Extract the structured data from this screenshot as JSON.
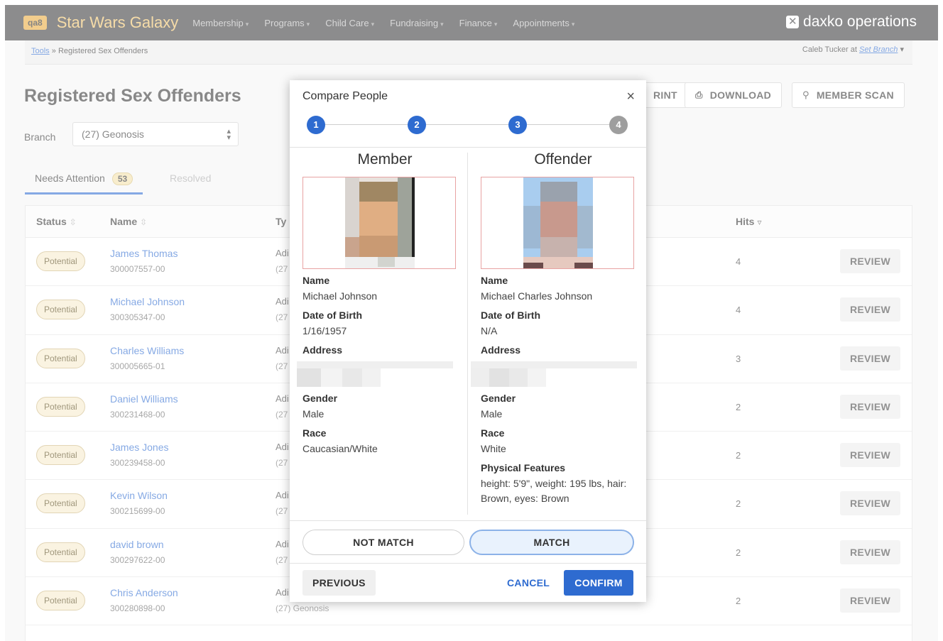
{
  "nav": {
    "env_badge": "qa8",
    "app_name": "Star Wars Galaxy",
    "items": [
      "Membership",
      "Programs",
      "Child Care",
      "Fundraising",
      "Finance",
      "Appointments"
    ],
    "brand": "daxko operations"
  },
  "breadcrumb": {
    "root": "Tools",
    "separator": "»",
    "current": "Registered Sex Offenders"
  },
  "user": {
    "name": "Caleb Tucker at",
    "branch_link": "Set Branch"
  },
  "page": {
    "title": "Registered Sex Offenders",
    "branch_label": "Branch",
    "branch_value": "(27) Geonosis",
    "tab_needs_attention": "Needs Attention",
    "tab_needs_attention_count": "53",
    "tab_resolved": "Resolved",
    "print_label": "PRINT",
    "print_partial": "RINT",
    "download_label": "DOWNLOAD",
    "member_scan_label": "MEMBER SCAN"
  },
  "table": {
    "headers": {
      "status": "Status",
      "name": "Name",
      "type": "Ty",
      "hits": "Hits"
    },
    "review_label": "REVIEW",
    "rows": [
      {
        "status": "Potential",
        "name": "James Thomas",
        "id": "300007557-00",
        "type": "Adi",
        "type_sub": "(27",
        "hits": "4"
      },
      {
        "status": "Potential",
        "name": "Michael Johnson",
        "id": "300305347-00",
        "type": "Adi",
        "type_sub": "(27",
        "hits": "4"
      },
      {
        "status": "Potential",
        "name": "Charles Williams",
        "id": "300005665-01",
        "type": "Adi",
        "type_sub": "(27",
        "hits": "3"
      },
      {
        "status": "Potential",
        "name": "Daniel Williams",
        "id": "300231468-00",
        "type": "Adi",
        "type_sub": "(27",
        "hits": "2"
      },
      {
        "status": "Potential",
        "name": "James Jones",
        "id": "300239458-00",
        "type": "Adi",
        "type_sub": "(27",
        "hits": "2"
      },
      {
        "status": "Potential",
        "name": "Kevin Wilson",
        "id": "300215699-00",
        "type": "Adi",
        "type_sub": "(27",
        "hits": "2"
      },
      {
        "status": "Potential",
        "name": "david brown",
        "id": "300297622-00",
        "type": "Adi",
        "type_sub": "(27",
        "hits": "2"
      },
      {
        "status": "Potential",
        "name": "Chris Anderson",
        "id": "300280898-00",
        "type": "Adi",
        "type_sub": "(27) Geonosis",
        "hits": "2"
      }
    ]
  },
  "modal": {
    "title": "Compare People",
    "close_glyph": "×",
    "steps": [
      "1",
      "2",
      "3",
      "4"
    ],
    "member": {
      "heading": "Member",
      "name_label": "Name",
      "name": "Michael Johnson",
      "dob_label": "Date of Birth",
      "dob": "1/16/1957",
      "address_label": "Address",
      "gender_label": "Gender",
      "gender": "Male",
      "race_label": "Race",
      "race": "Caucasian/White"
    },
    "offender": {
      "heading": "Offender",
      "name_label": "Name",
      "name": "Michael Charles Johnson",
      "dob_label": "Date of Birth",
      "dob": "N/A",
      "address_label": "Address",
      "gender_label": "Gender",
      "gender": "Male",
      "race_label": "Race",
      "race": "White",
      "features_label": "Physical Features",
      "features": "height: 5'9\", weight: 195 lbs, hair: Brown, eyes: Brown"
    },
    "not_match_label": "NOT MATCH",
    "match_label": "MATCH",
    "previous_label": "PREVIOUS",
    "cancel_label": "CANCEL",
    "confirm_label": "CONFIRM"
  },
  "colors": {
    "accent": "#2e6bd0",
    "nav_bg": "#3a3a3c",
    "app_name": "#f0c36a",
    "env_badge": "#e9a93b",
    "pill_bg": "#f6ebcb"
  }
}
